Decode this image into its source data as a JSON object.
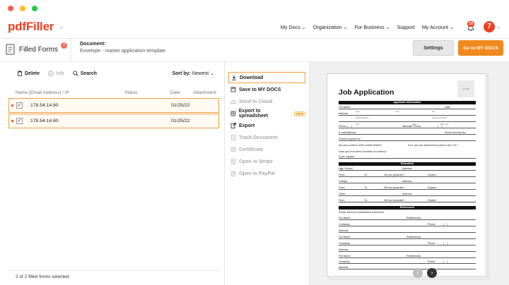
{
  "header": {
    "logo": "pdfFiller",
    "nav": [
      "My Docs",
      "Organization",
      "For Business",
      "Support",
      "My Account"
    ],
    "notif_count": "10"
  },
  "subheader": {
    "title": "Filled Forms",
    "badge": "2",
    "doc_label": "Document:",
    "doc_name": "Envelope - master application template",
    "settings": "Settings",
    "go": "Go to MY DOCS"
  },
  "left": {
    "toolbar": {
      "delete": "Delete",
      "info": "Info",
      "search": "Search"
    },
    "sort_label": "Sort by:",
    "sort_value": "Newest",
    "columns": [
      "Name [Email Address] / IP",
      "Status",
      "Date",
      "Attachment"
    ],
    "rows": [
      {
        "ip": "178.54.14.60",
        "date": "01/25/22"
      },
      {
        "ip": "178.54.14.60",
        "date": "01/25/22"
      }
    ],
    "footer": "2 of 2 filled forms selected"
  },
  "actions": [
    {
      "label": "Download",
      "icon": "download-icon"
    },
    {
      "label": "Save to MY DOCS",
      "icon": "save-icon"
    },
    {
      "label": "Send to Cloud",
      "icon": "cloud-icon"
    },
    {
      "label": "Export to spreadsheet",
      "icon": "spreadsheet-icon",
      "badge": "NEW"
    },
    {
      "label": "Export",
      "icon": "export-icon"
    },
    {
      "label": "Track Document",
      "icon": "track-icon"
    },
    {
      "label": "Certificate",
      "icon": "certificate-icon"
    },
    {
      "label": "Open in Stripe",
      "icon": "stripe-icon"
    },
    {
      "label": "Open in PayPal",
      "icon": "paypal-icon"
    }
  ],
  "preview": {
    "title": "Job Application",
    "logo_text": "Image",
    "sec_applicant": "Applicant Information",
    "sec_education": "Education",
    "sec_references": "References",
    "f_fullname": "Full Name:",
    "f_date": "Date:",
    "f_address": "Address:",
    "f_phone": "Phone:",
    "f_altphone": "Alternate Phone:",
    "f_email": "E-mail Address:",
    "f_ssn": "Social Security No.:",
    "f_position": "Position Applied for:",
    "f_citizen": "Are you a citizen of the United States?",
    "f_authorized": "If no, are you authorized to work in the U.S.?",
    "f_felony": "Have you ever been convicted of a felony?",
    "f_explain": "If yes, explain:",
    "f_highschool": "High School:",
    "f_college": "College:",
    "f_other": "Other:",
    "f_from": "From:",
    "f_to": "To:",
    "f_graduate": "Did you graduate?",
    "f_degree": "Degree:",
    "f_refs_note": "Please list three professional references.",
    "f_relationship": "Relationship:",
    "f_company": "Company:",
    "f_address2": "Address:",
    "sub_last": "Last",
    "sub_first": "First",
    "sub_mi": "M.I.",
    "sub_street": "Street Address",
    "sub_apt": "Apartment/Unit #",
    "sub_city": "City",
    "sub_state": "State",
    "sub_zip": "ZIP Code",
    "yes": "YES",
    "no": "NO"
  }
}
